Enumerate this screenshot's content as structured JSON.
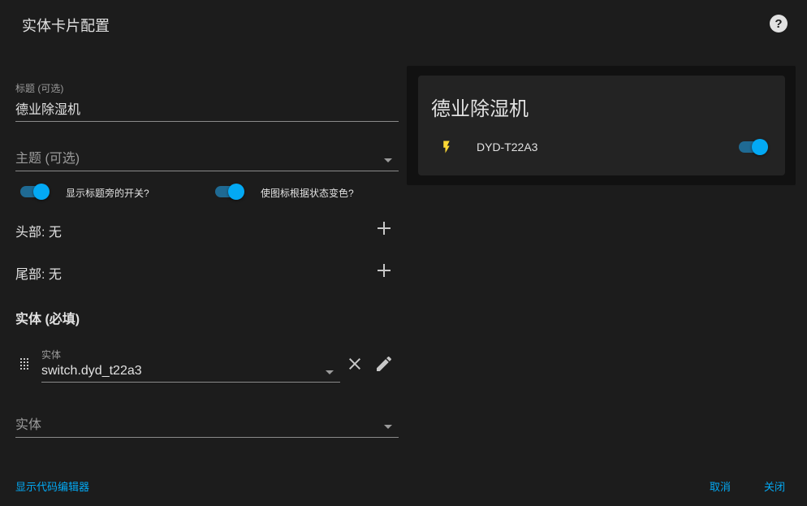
{
  "dialog": {
    "title": "实体卡片配置",
    "help_icon": "help-circle-icon"
  },
  "form": {
    "title_field": {
      "label": "标题 (可选)",
      "value": "德业除湿机"
    },
    "theme_field": {
      "placeholder": "主题 (可选)"
    },
    "toggles": [
      {
        "label": "显示标题旁的开关?",
        "state": "on"
      },
      {
        "label": "使图标根据状态变色?",
        "state": "on"
      }
    ],
    "header": {
      "label": "头部: 无"
    },
    "footer": {
      "label": "尾部: 无"
    },
    "entities": {
      "title": "实体 (必填)",
      "items": [
        {
          "label": "实体",
          "value": "switch.dyd_t22a3"
        }
      ],
      "new_entity_placeholder": "实体"
    }
  },
  "preview": {
    "card_title": "德业除湿机",
    "rows": [
      {
        "icon": "flash-icon",
        "name": "DYD-T22A3",
        "state": "on"
      }
    ]
  },
  "footer_actions": {
    "show_code_editor": "显示代码编辑器",
    "cancel": "取消",
    "close": "关闭"
  },
  "colors": {
    "accent": "#03a9f4",
    "background": "#1c1c1c",
    "card": "#232323",
    "icon_active": "#fdd835"
  }
}
